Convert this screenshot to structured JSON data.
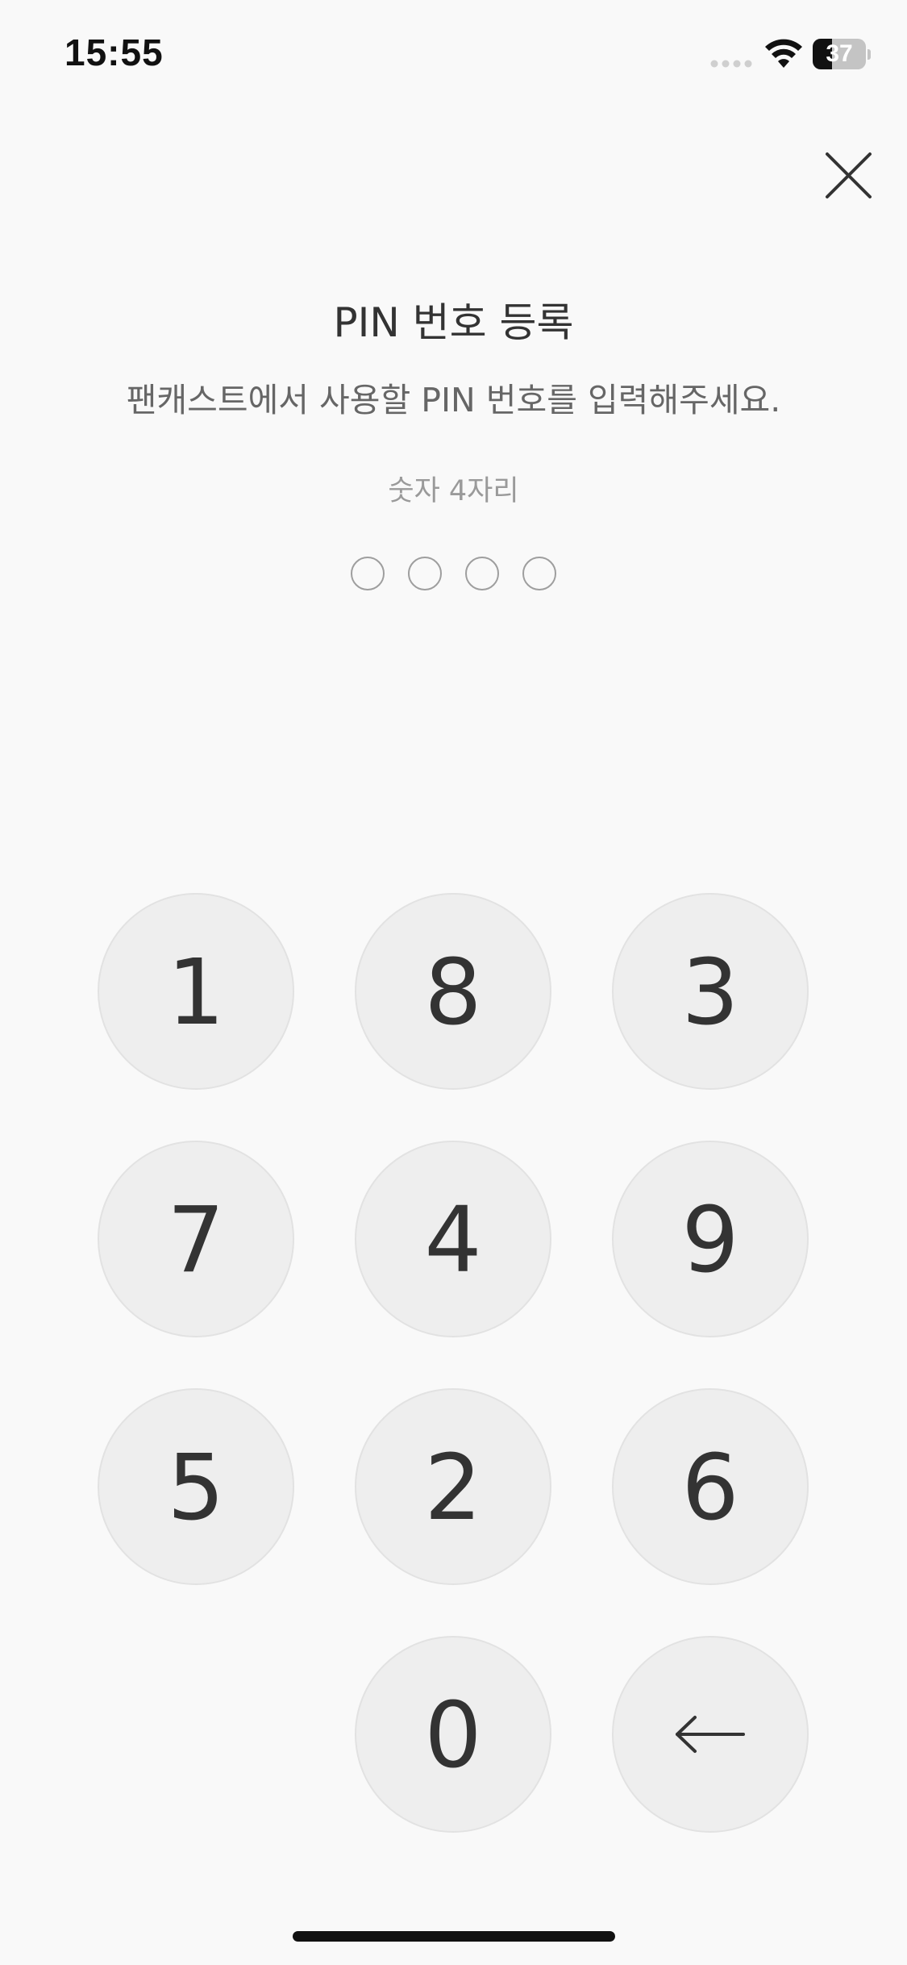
{
  "status_bar": {
    "time": "15:55",
    "battery_level": "37",
    "battery_fraction": 0.37,
    "signal_icon": "signal-dots-icon",
    "wifi_icon": "wifi-icon"
  },
  "header": {
    "close_icon": "close-icon",
    "title": "PIN 번호 등록",
    "subtitle": "팬캐스트에서 사용할 PIN 번호를 입력해주세요.",
    "hint": "숫자 4자리"
  },
  "pin": {
    "length": 4,
    "filled": 0
  },
  "keypad": {
    "keys": [
      "1",
      "8",
      "3",
      "7",
      "4",
      "9",
      "5",
      "2",
      "6",
      "0"
    ],
    "backspace_icon": "backspace-arrow-icon"
  },
  "colors": {
    "background": "#f9f9f9",
    "key_background": "#eeeeee",
    "text": "#333333",
    "subtext": "#666666",
    "hint": "#9a9a9a"
  }
}
